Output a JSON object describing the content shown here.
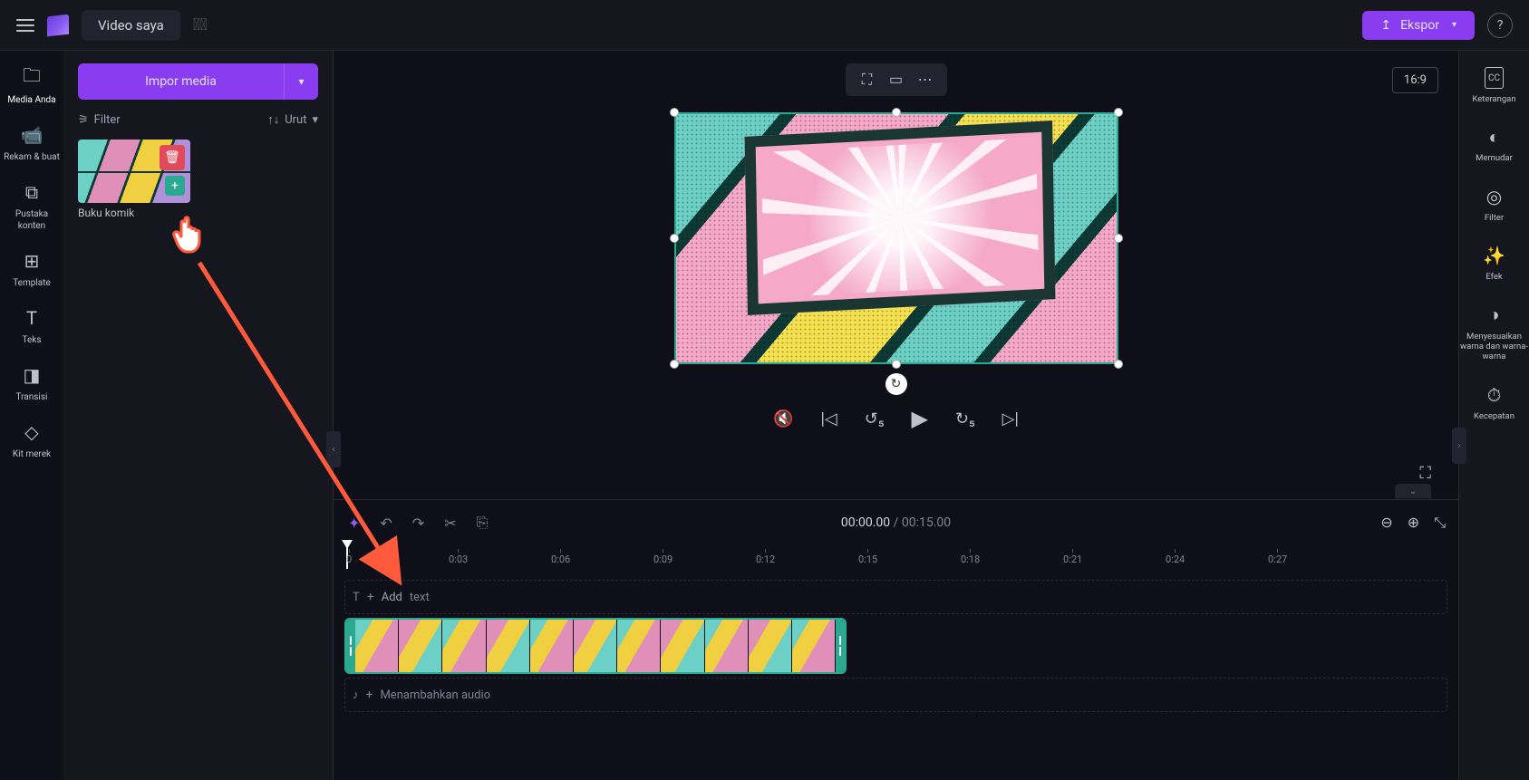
{
  "header": {
    "project_title": "Video saya",
    "export_label": "Ekspor"
  },
  "left_rail": {
    "items": [
      {
        "icon": "🗀",
        "label": "Media Anda"
      },
      {
        "icon": "⎚",
        "label": "Rekam &amp; buat"
      },
      {
        "icon": "⧉",
        "label": "Pustaka konten"
      },
      {
        "icon": "⊞",
        "label": "Template"
      },
      {
        "icon": "T",
        "label": "Teks"
      },
      {
        "icon": "◧",
        "label": "Transisi"
      },
      {
        "icon": "◇",
        "label": "Kit merek"
      }
    ]
  },
  "media_panel": {
    "import_label": "Impor media",
    "filter_label": "Filter",
    "sort_label": "Urut",
    "thumb_name": "Buku komik"
  },
  "preview": {
    "aspect_ratio": "16:9"
  },
  "timeline": {
    "current_time": "00:00.00",
    "duration": "00:15.00",
    "ruler_ticks": [
      "0",
      "0:03",
      "0:06",
      "0:09",
      "0:12",
      "0:15",
      "0:18",
      "0:21",
      "0:24",
      "0:27"
    ],
    "text_track_label": "Add",
    "text_track_suffix": "text",
    "audio_track_label": "Menambahkan audio"
  },
  "right_rail": {
    "items": [
      {
        "icon": "CC",
        "label": "Keterangan"
      },
      {
        "icon": "◐",
        "label": "Memudar"
      },
      {
        "icon": "◎",
        "label": "Filter"
      },
      {
        "icon": "✨",
        "label": "Efek"
      },
      {
        "icon": "◑",
        "label": "Menyesuaikan warna dan warna-warna"
      },
      {
        "icon": "⏱",
        "label": "Kecepatan"
      }
    ]
  }
}
